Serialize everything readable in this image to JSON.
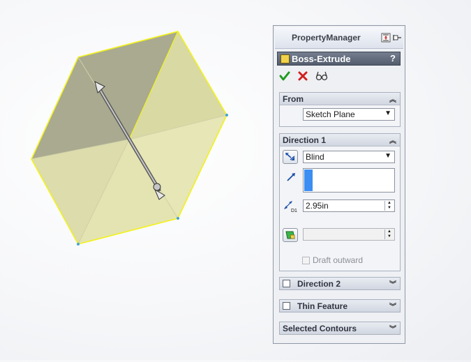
{
  "property_manager": {
    "title": "PropertyManager",
    "feature_name": "Boss-Extrude",
    "help_label": "?",
    "actions": {
      "ok_icon": "check-icon",
      "cancel_icon": "x-icon",
      "preview_icon": "glasses-icon",
      "ok_color": "#1f9a1f",
      "cancel_color": "#d22020"
    },
    "from_group": {
      "title": "From",
      "start_condition": "Sketch Plane"
    },
    "direction1": {
      "title": "Direction 1",
      "end_condition": "Blind",
      "depth": "2.95in",
      "depth_icon_label": "D1",
      "draft_value": "",
      "draft_outward_label": "Draft outward"
    },
    "direction2": {
      "title": "Direction 2"
    },
    "thin_feature": {
      "title": "Thin Feature"
    },
    "selected_contours": {
      "title": "Selected Contours"
    }
  },
  "viewport": {
    "model_face_color": "#e3e3b0",
    "model_shadow_color": "#a7a88a",
    "edge_color": "#f2f21e"
  }
}
